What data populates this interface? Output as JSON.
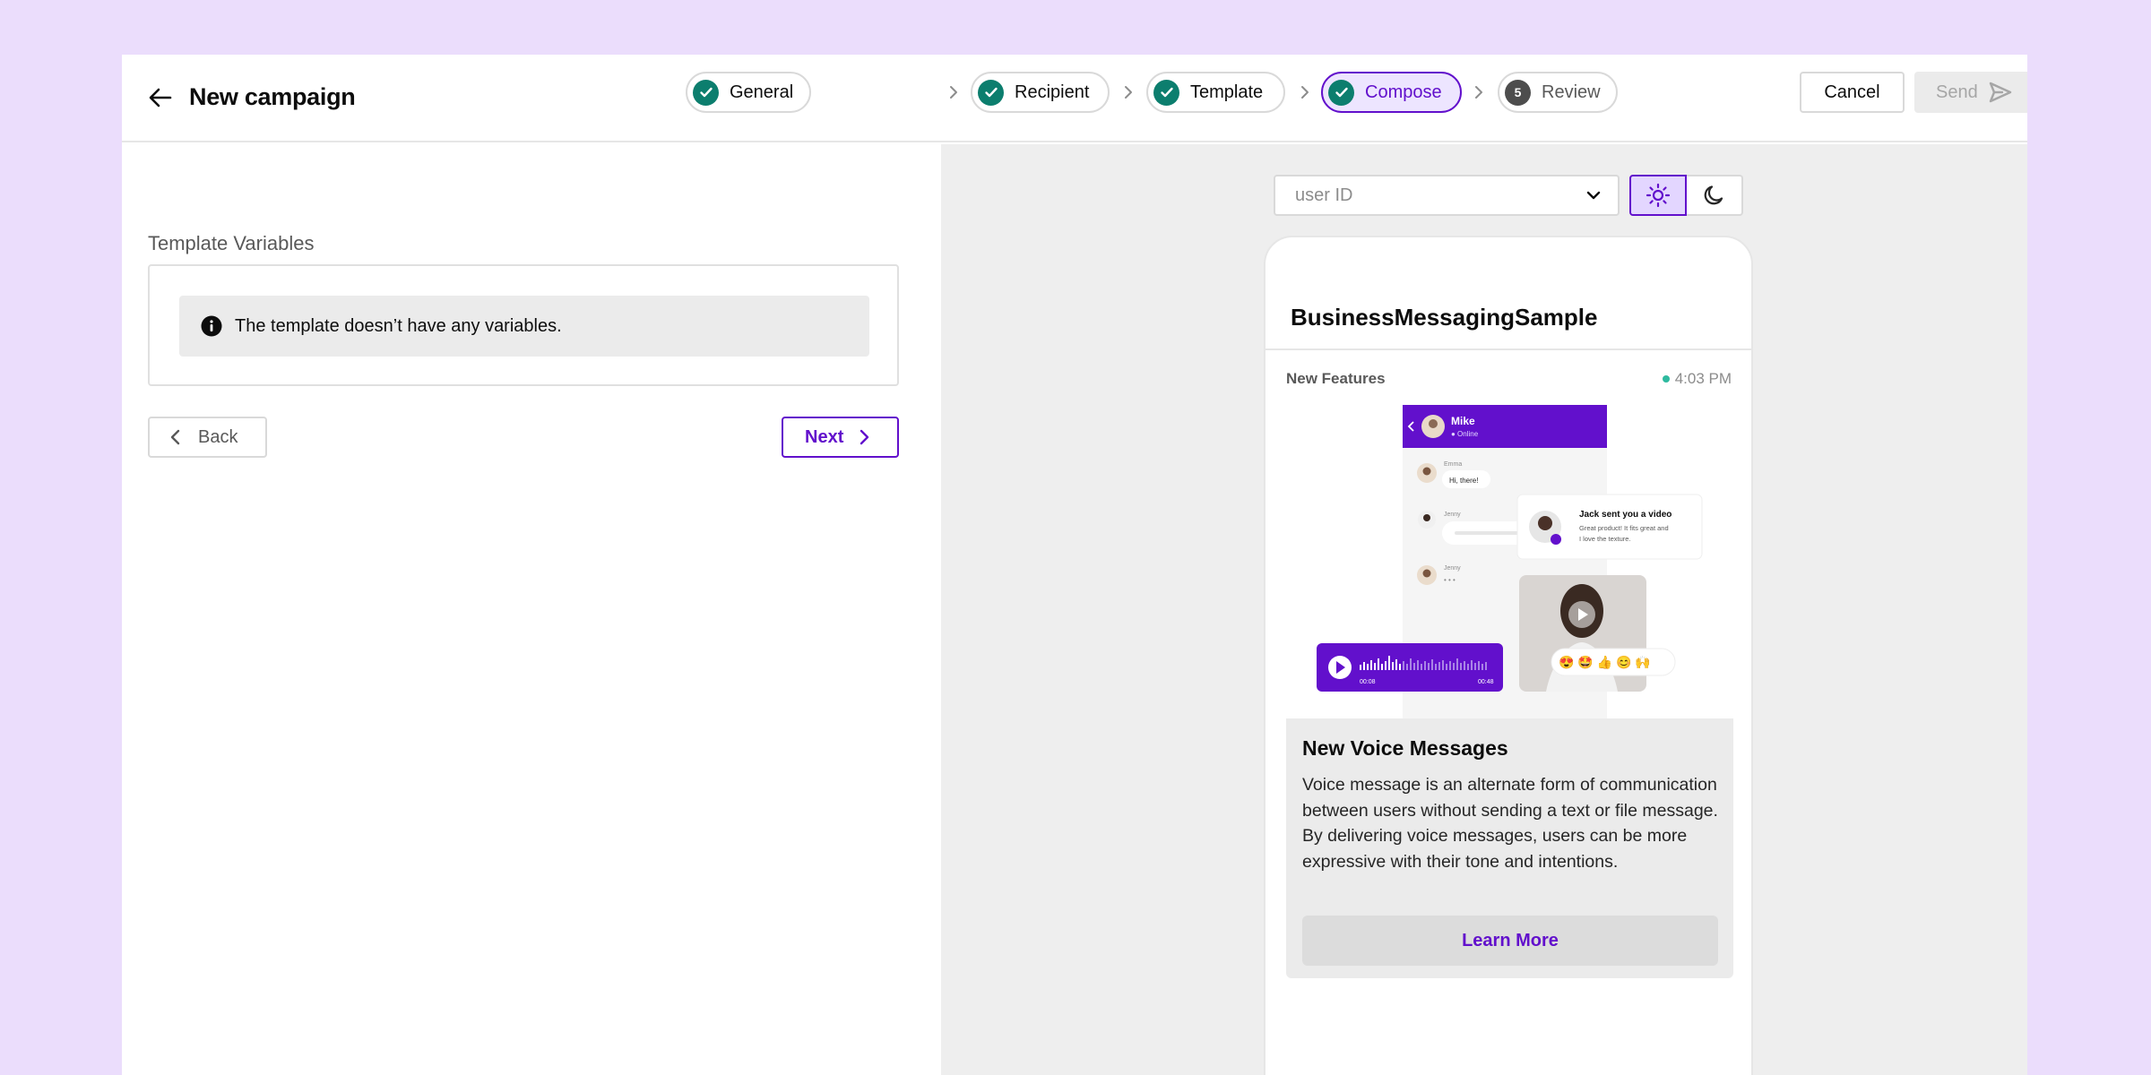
{
  "header": {
    "title": "New campaign",
    "steps": [
      {
        "label": "General",
        "state": "done"
      },
      {
        "label": "Recipient",
        "state": "done"
      },
      {
        "label": "Template",
        "state": "done"
      },
      {
        "label": "Compose",
        "state": "active"
      },
      {
        "label": "Review",
        "state": "todo",
        "number": "5"
      }
    ],
    "cancel_label": "Cancel",
    "send_label": "Send"
  },
  "compose": {
    "section_label": "Template Variables",
    "info_text": "The template doesn’t have any variables.",
    "back_label": "Back",
    "next_label": "Next"
  },
  "preview": {
    "user_select_placeholder": "user ID",
    "theme_selected": "light",
    "channel_name": "BusinessMessagingSample",
    "message": {
      "sender": "New Features",
      "time": "4:03 PM",
      "card_title": "New Voice Messages",
      "card_description": "Voice message is an alternate form of communication between users without sending a text or file message. By delivering voice messages, users can be more expressive with their tone and intentions.",
      "button_label": "Learn More",
      "illustration": {
        "header_name": "Mike",
        "header_status": "● Online",
        "user1": "Emma",
        "bubble1": "Hi, there!",
        "user2": "Jenny",
        "user3": "Jenny",
        "notification_title": "Jack sent you a video",
        "notification_body_1": "Great product! It fits great and",
        "notification_body_2": "I love the texture.",
        "audio_start": "00:08",
        "audio_end": "00:48",
        "reactions": "😍 🤩 👍 😊 🙌"
      }
    }
  },
  "colors": {
    "background": "#EBDDFC",
    "accent": "#6210CC",
    "step_done": "#0C7E6E",
    "online": "#2EBA9F"
  }
}
